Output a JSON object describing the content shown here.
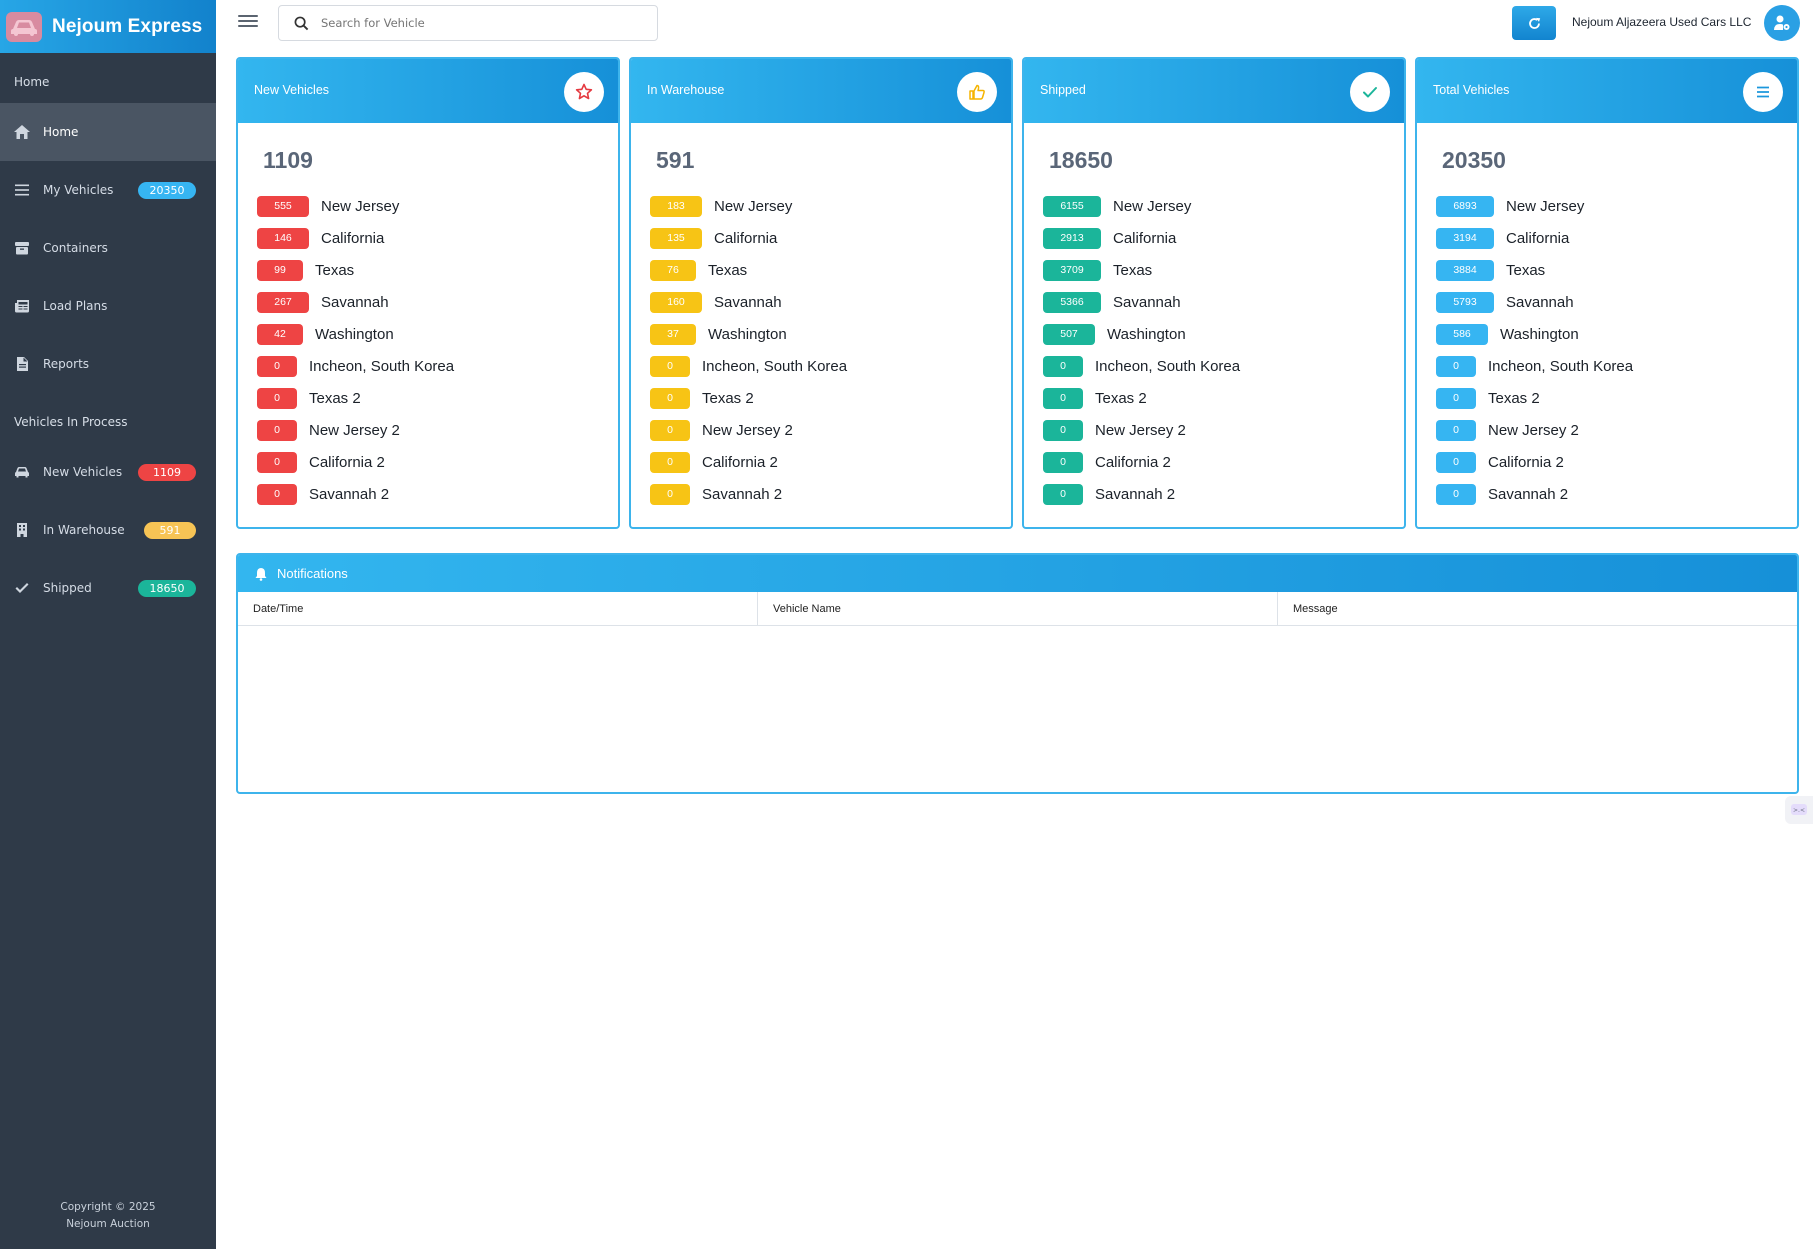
{
  "brand": {
    "title": "Nejoum Express"
  },
  "sidebar": {
    "section_home": "Home",
    "home_items": [
      {
        "label": "Home"
      },
      {
        "label": "My Vehicles",
        "badge": "20350"
      },
      {
        "label": "Containers"
      },
      {
        "label": "Load Plans"
      },
      {
        "label": "Reports"
      }
    ],
    "section_process": "Vehicles In Process",
    "process_items": [
      {
        "label": "New Vehicles",
        "badge": "1109"
      },
      {
        "label": "In Warehouse",
        "badge": "591"
      },
      {
        "label": "Shipped",
        "badge": "18650"
      }
    ],
    "copyright_line1": "Copyright © 2025",
    "copyright_line2": "Nejoum Auction"
  },
  "topbar": {
    "search_placeholder": "Search for Vehicle",
    "company": "Nejoum Aljazeera Used Cars LLC"
  },
  "colors": {
    "red": "#ee4444",
    "yellow": "#f7c415",
    "green": "#1bb59a",
    "blue": "#36b5f2",
    "accent": "#1690d8"
  },
  "cards": [
    {
      "title": "New Vehicles",
      "icon": "star-icon",
      "total": "1109",
      "rows": [
        {
          "count": "555",
          "location": "New Jersey"
        },
        {
          "count": "146",
          "location": "California"
        },
        {
          "count": "99",
          "location": "Texas"
        },
        {
          "count": "267",
          "location": "Savannah"
        },
        {
          "count": "42",
          "location": "Washington"
        },
        {
          "count": "0",
          "location": "Incheon, South Korea"
        },
        {
          "count": "0",
          "location": "Texas 2"
        },
        {
          "count": "0",
          "location": "New Jersey 2"
        },
        {
          "count": "0",
          "location": "California 2"
        },
        {
          "count": "0",
          "location": "Savannah 2"
        }
      ]
    },
    {
      "title": "In Warehouse",
      "icon": "thumbs-up-icon",
      "total": "591",
      "rows": [
        {
          "count": "183",
          "location": "New Jersey"
        },
        {
          "count": "135",
          "location": "California"
        },
        {
          "count": "76",
          "location": "Texas"
        },
        {
          "count": "160",
          "location": "Savannah"
        },
        {
          "count": "37",
          "location": "Washington"
        },
        {
          "count": "0",
          "location": "Incheon, South Korea"
        },
        {
          "count": "0",
          "location": "Texas 2"
        },
        {
          "count": "0",
          "location": "New Jersey 2"
        },
        {
          "count": "0",
          "location": "California 2"
        },
        {
          "count": "0",
          "location": "Savannah 2"
        }
      ]
    },
    {
      "title": "Shipped",
      "icon": "check-icon",
      "total": "18650",
      "rows": [
        {
          "count": "6155",
          "location": "New Jersey"
        },
        {
          "count": "2913",
          "location": "California"
        },
        {
          "count": "3709",
          "location": "Texas"
        },
        {
          "count": "5366",
          "location": "Savannah"
        },
        {
          "count": "507",
          "location": "Washington"
        },
        {
          "count": "0",
          "location": "Incheon, South Korea"
        },
        {
          "count": "0",
          "location": "Texas 2"
        },
        {
          "count": "0",
          "location": "New Jersey 2"
        },
        {
          "count": "0",
          "location": "California 2"
        },
        {
          "count": "0",
          "location": "Savannah 2"
        }
      ]
    },
    {
      "title": "Total Vehicles",
      "icon": "list-icon",
      "total": "20350",
      "rows": [
        {
          "count": "6893",
          "location": "New Jersey"
        },
        {
          "count": "3194",
          "location": "California"
        },
        {
          "count": "3884",
          "location": "Texas"
        },
        {
          "count": "5793",
          "location": "Savannah"
        },
        {
          "count": "586",
          "location": "Washington"
        },
        {
          "count": "0",
          "location": "Incheon, South Korea"
        },
        {
          "count": "0",
          "location": "Texas 2"
        },
        {
          "count": "0",
          "location": "New Jersey 2"
        },
        {
          "count": "0",
          "location": "California 2"
        },
        {
          "count": "0",
          "location": "Savannah 2"
        }
      ]
    }
  ],
  "notifications": {
    "title": "Notifications",
    "columns": [
      "Date/Time",
      "Vehicle Name",
      "Message"
    ]
  }
}
